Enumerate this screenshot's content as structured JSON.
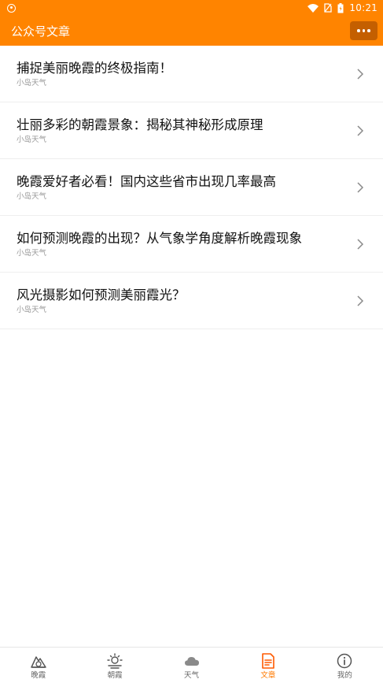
{
  "status_bar": {
    "time": "10:21"
  },
  "toolbar": {
    "title": "公众号文章"
  },
  "articles": [
    {
      "title": "捕捉美丽晚霞的终极指南！",
      "source": "小岛天气"
    },
    {
      "title": "壮丽多彩的朝霞景象：揭秘其神秘形成原理",
      "source": "小岛天气"
    },
    {
      "title": "晚霞爱好者必看！国内这些省市出现几率最高",
      "source": "小岛天气"
    },
    {
      "title": "如何预测晚霞的出现？从气象学角度解析晚霞现象",
      "source": "小岛天气"
    },
    {
      "title": "风光摄影如何预测美丽霞光？",
      "source": "小岛天气"
    }
  ],
  "tabs": [
    {
      "label": "晚霞",
      "icon": "sunset-mountain-icon",
      "active": false
    },
    {
      "label": "朝霞",
      "icon": "sunrise-icon",
      "active": false
    },
    {
      "label": "天气",
      "icon": "cloud-icon",
      "active": false
    },
    {
      "label": "文章",
      "icon": "article-icon",
      "active": true
    },
    {
      "label": "我的",
      "icon": "info-icon",
      "active": false
    }
  ],
  "colors": {
    "brand": "#ff8400",
    "active_tab": "#ff7a00"
  }
}
